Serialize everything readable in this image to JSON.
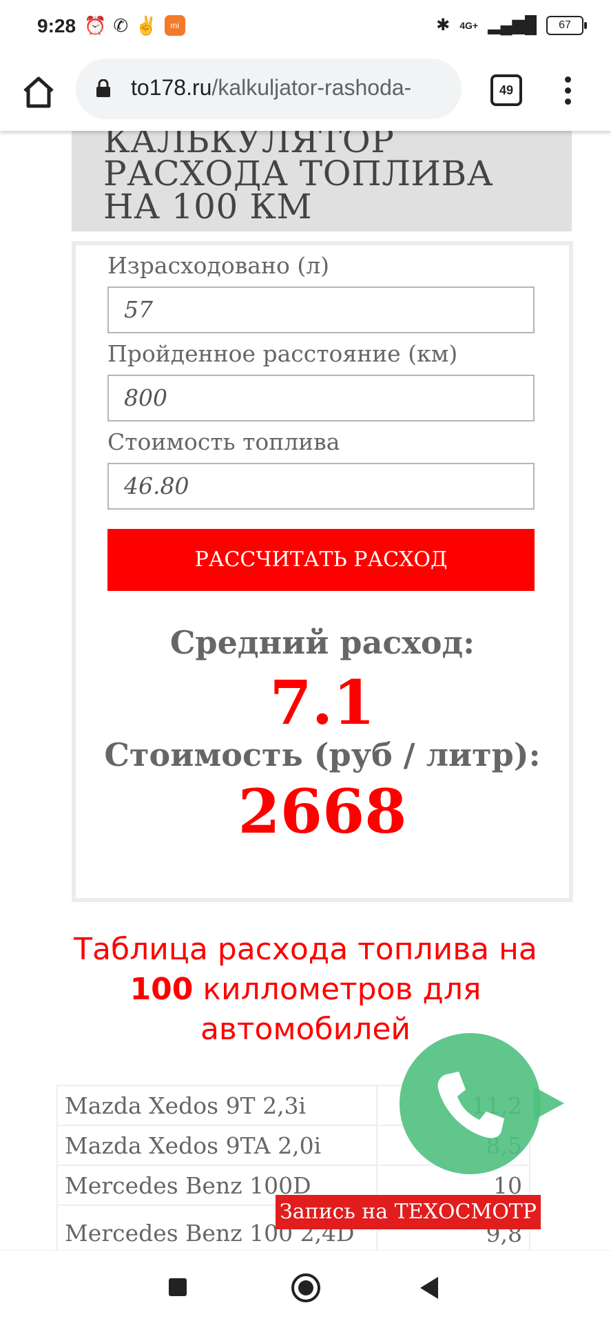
{
  "status_bar": {
    "time": "9:28",
    "network": "4G+",
    "battery": "67"
  },
  "browser": {
    "url_domain": "to178.ru",
    "url_path": "/kalkuljator-rashoda-",
    "tab_count": "49"
  },
  "page": {
    "heading": "КАЛЬКУЛЯТОР РАСХОДА ТОПЛИВА НА 100 КМ",
    "fields": [
      {
        "label": "Израсходовано (л)",
        "value": "57"
      },
      {
        "label": "Пройденное расстояние (км)",
        "value": "800"
      },
      {
        "label": "Стоимость топлива",
        "value": "46.80"
      }
    ],
    "calc_button": "РАССЧИТАТЬ РАСХОД",
    "avg_label": "Средний расход:",
    "avg_value": "7.1",
    "cost_label": "Стоимость (руб / литр):",
    "cost_value": "2668",
    "table_title_before": "Таблица расхода топлива на",
    "table_title_number": "100",
    "table_title_after": "киллометров для автомобилей",
    "table_rows": [
      {
        "car": "Mazda Xedos 9T 2,3i",
        "value": "11,2"
      },
      {
        "car": "Mazda Xedos 9TA 2,0i",
        "value": "8,5"
      },
      {
        "car": "Mercedes Benz 100D",
        "value": "10"
      },
      {
        "car": "Mercedes Benz 100 2,4D",
        "value": "9,8"
      }
    ]
  },
  "overlays": {
    "promo_banner": "Запись на ТЕХОСМОТР"
  },
  "colors": {
    "accent": "#ff0000",
    "whatsapp_green": "#4fc07f",
    "heading_bg": "#e0e0e0"
  }
}
